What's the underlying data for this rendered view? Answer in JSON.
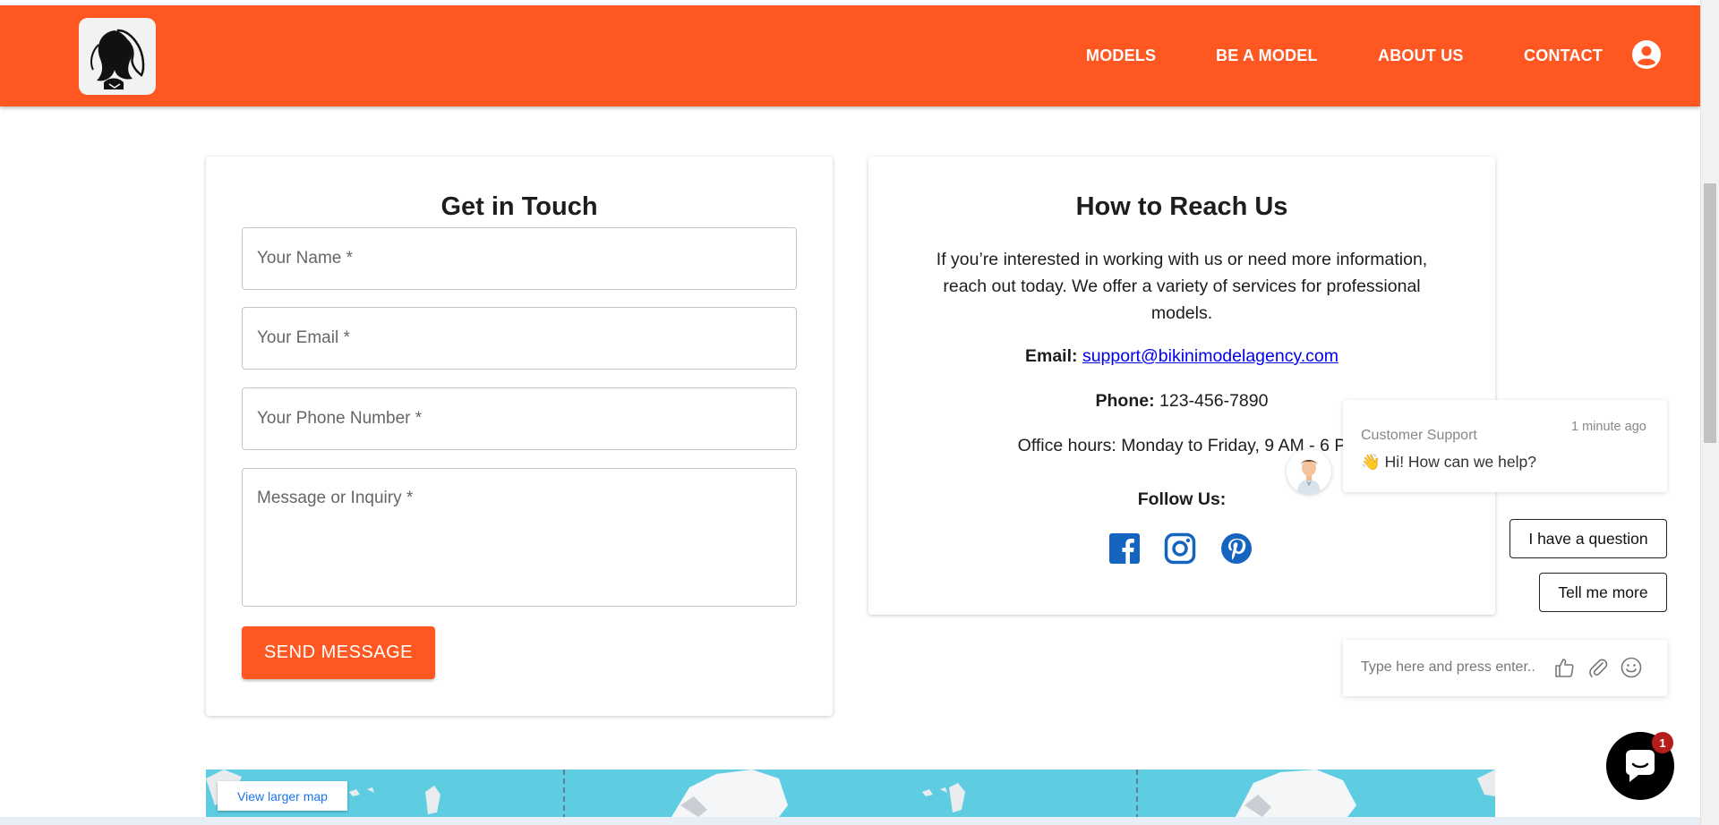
{
  "nav": {
    "items": [
      {
        "label": "MODELS"
      },
      {
        "label": "BE A MODEL"
      },
      {
        "label": "ABOUT US"
      },
      {
        "label": "CONTACT"
      }
    ],
    "user_icon": "user-circle-icon",
    "logo_icon": "woman-silhouette-logo"
  },
  "contact_form": {
    "title": "Get in Touch",
    "name_placeholder": "Your Name *",
    "email_placeholder": "Your Email *",
    "phone_placeholder": "Your Phone Number *",
    "message_placeholder": "Message or Inquiry *",
    "submit_label": "SEND MESSAGE"
  },
  "reach_us": {
    "title": "How to Reach Us",
    "intro": "If you’re interested in working with us or need more information, reach out today. We offer a variety of services for professional models.",
    "email_label": "Email:",
    "email_value": "support@bikinimodelagency.com",
    "phone_label": "Phone:",
    "phone_value": "123-456-7890",
    "hours": "Office hours: Monday to Friday, 9 AM - 6 P",
    "follow_label": "Follow Us:",
    "social_icons": [
      "facebook-icon",
      "instagram-icon",
      "pinterest-icon"
    ]
  },
  "map": {
    "link_label": "View larger map"
  },
  "chat": {
    "agent": "Customer Support",
    "time": "1 minute ago",
    "message": "Hi! How can we help?",
    "quick_replies": [
      "I have a question",
      "Tell me more"
    ],
    "input_placeholder": "Type here and press enter..",
    "badge_count": "1"
  },
  "colors": {
    "brand": "#ff5722",
    "link": "#0000ee",
    "map_water": "#5ecde2"
  }
}
